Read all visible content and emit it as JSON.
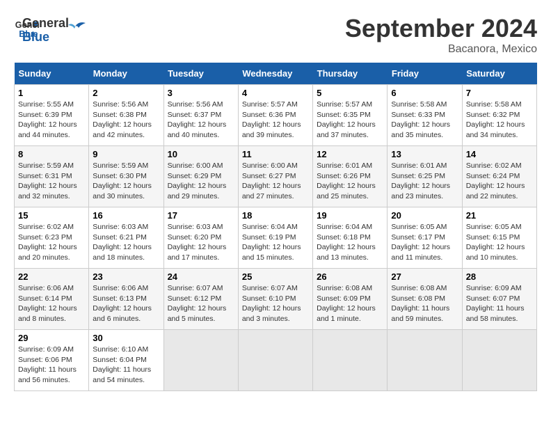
{
  "logo": {
    "line1": "General",
    "line2": "Blue"
  },
  "title": "September 2024",
  "location": "Bacanora, Mexico",
  "days_header": [
    "Sunday",
    "Monday",
    "Tuesday",
    "Wednesday",
    "Thursday",
    "Friday",
    "Saturday"
  ],
  "weeks": [
    [
      {
        "day": "1",
        "info": "Sunrise: 5:55 AM\nSunset: 6:39 PM\nDaylight: 12 hours\nand 44 minutes."
      },
      {
        "day": "2",
        "info": "Sunrise: 5:56 AM\nSunset: 6:38 PM\nDaylight: 12 hours\nand 42 minutes."
      },
      {
        "day": "3",
        "info": "Sunrise: 5:56 AM\nSunset: 6:37 PM\nDaylight: 12 hours\nand 40 minutes."
      },
      {
        "day": "4",
        "info": "Sunrise: 5:57 AM\nSunset: 6:36 PM\nDaylight: 12 hours\nand 39 minutes."
      },
      {
        "day": "5",
        "info": "Sunrise: 5:57 AM\nSunset: 6:35 PM\nDaylight: 12 hours\nand 37 minutes."
      },
      {
        "day": "6",
        "info": "Sunrise: 5:58 AM\nSunset: 6:33 PM\nDaylight: 12 hours\nand 35 minutes."
      },
      {
        "day": "7",
        "info": "Sunrise: 5:58 AM\nSunset: 6:32 PM\nDaylight: 12 hours\nand 34 minutes."
      }
    ],
    [
      {
        "day": "8",
        "info": "Sunrise: 5:59 AM\nSunset: 6:31 PM\nDaylight: 12 hours\nand 32 minutes."
      },
      {
        "day": "9",
        "info": "Sunrise: 5:59 AM\nSunset: 6:30 PM\nDaylight: 12 hours\nand 30 minutes."
      },
      {
        "day": "10",
        "info": "Sunrise: 6:00 AM\nSunset: 6:29 PM\nDaylight: 12 hours\nand 29 minutes."
      },
      {
        "day": "11",
        "info": "Sunrise: 6:00 AM\nSunset: 6:27 PM\nDaylight: 12 hours\nand 27 minutes."
      },
      {
        "day": "12",
        "info": "Sunrise: 6:01 AM\nSunset: 6:26 PM\nDaylight: 12 hours\nand 25 minutes."
      },
      {
        "day": "13",
        "info": "Sunrise: 6:01 AM\nSunset: 6:25 PM\nDaylight: 12 hours\nand 23 minutes."
      },
      {
        "day": "14",
        "info": "Sunrise: 6:02 AM\nSunset: 6:24 PM\nDaylight: 12 hours\nand 22 minutes."
      }
    ],
    [
      {
        "day": "15",
        "info": "Sunrise: 6:02 AM\nSunset: 6:23 PM\nDaylight: 12 hours\nand 20 minutes."
      },
      {
        "day": "16",
        "info": "Sunrise: 6:03 AM\nSunset: 6:21 PM\nDaylight: 12 hours\nand 18 minutes."
      },
      {
        "day": "17",
        "info": "Sunrise: 6:03 AM\nSunset: 6:20 PM\nDaylight: 12 hours\nand 17 minutes."
      },
      {
        "day": "18",
        "info": "Sunrise: 6:04 AM\nSunset: 6:19 PM\nDaylight: 12 hours\nand 15 minutes."
      },
      {
        "day": "19",
        "info": "Sunrise: 6:04 AM\nSunset: 6:18 PM\nDaylight: 12 hours\nand 13 minutes."
      },
      {
        "day": "20",
        "info": "Sunrise: 6:05 AM\nSunset: 6:17 PM\nDaylight: 12 hours\nand 11 minutes."
      },
      {
        "day": "21",
        "info": "Sunrise: 6:05 AM\nSunset: 6:15 PM\nDaylight: 12 hours\nand 10 minutes."
      }
    ],
    [
      {
        "day": "22",
        "info": "Sunrise: 6:06 AM\nSunset: 6:14 PM\nDaylight: 12 hours\nand 8 minutes."
      },
      {
        "day": "23",
        "info": "Sunrise: 6:06 AM\nSunset: 6:13 PM\nDaylight: 12 hours\nand 6 minutes."
      },
      {
        "day": "24",
        "info": "Sunrise: 6:07 AM\nSunset: 6:12 PM\nDaylight: 12 hours\nand 5 minutes."
      },
      {
        "day": "25",
        "info": "Sunrise: 6:07 AM\nSunset: 6:10 PM\nDaylight: 12 hours\nand 3 minutes."
      },
      {
        "day": "26",
        "info": "Sunrise: 6:08 AM\nSunset: 6:09 PM\nDaylight: 12 hours\nand 1 minute."
      },
      {
        "day": "27",
        "info": "Sunrise: 6:08 AM\nSunset: 6:08 PM\nDaylight: 11 hours\nand 59 minutes."
      },
      {
        "day": "28",
        "info": "Sunrise: 6:09 AM\nSunset: 6:07 PM\nDaylight: 11 hours\nand 58 minutes."
      }
    ],
    [
      {
        "day": "29",
        "info": "Sunrise: 6:09 AM\nSunset: 6:06 PM\nDaylight: 11 hours\nand 56 minutes."
      },
      {
        "day": "30",
        "info": "Sunrise: 6:10 AM\nSunset: 6:04 PM\nDaylight: 11 hours\nand 54 minutes."
      },
      {
        "day": "",
        "info": ""
      },
      {
        "day": "",
        "info": ""
      },
      {
        "day": "",
        "info": ""
      },
      {
        "day": "",
        "info": ""
      },
      {
        "day": "",
        "info": ""
      }
    ]
  ]
}
